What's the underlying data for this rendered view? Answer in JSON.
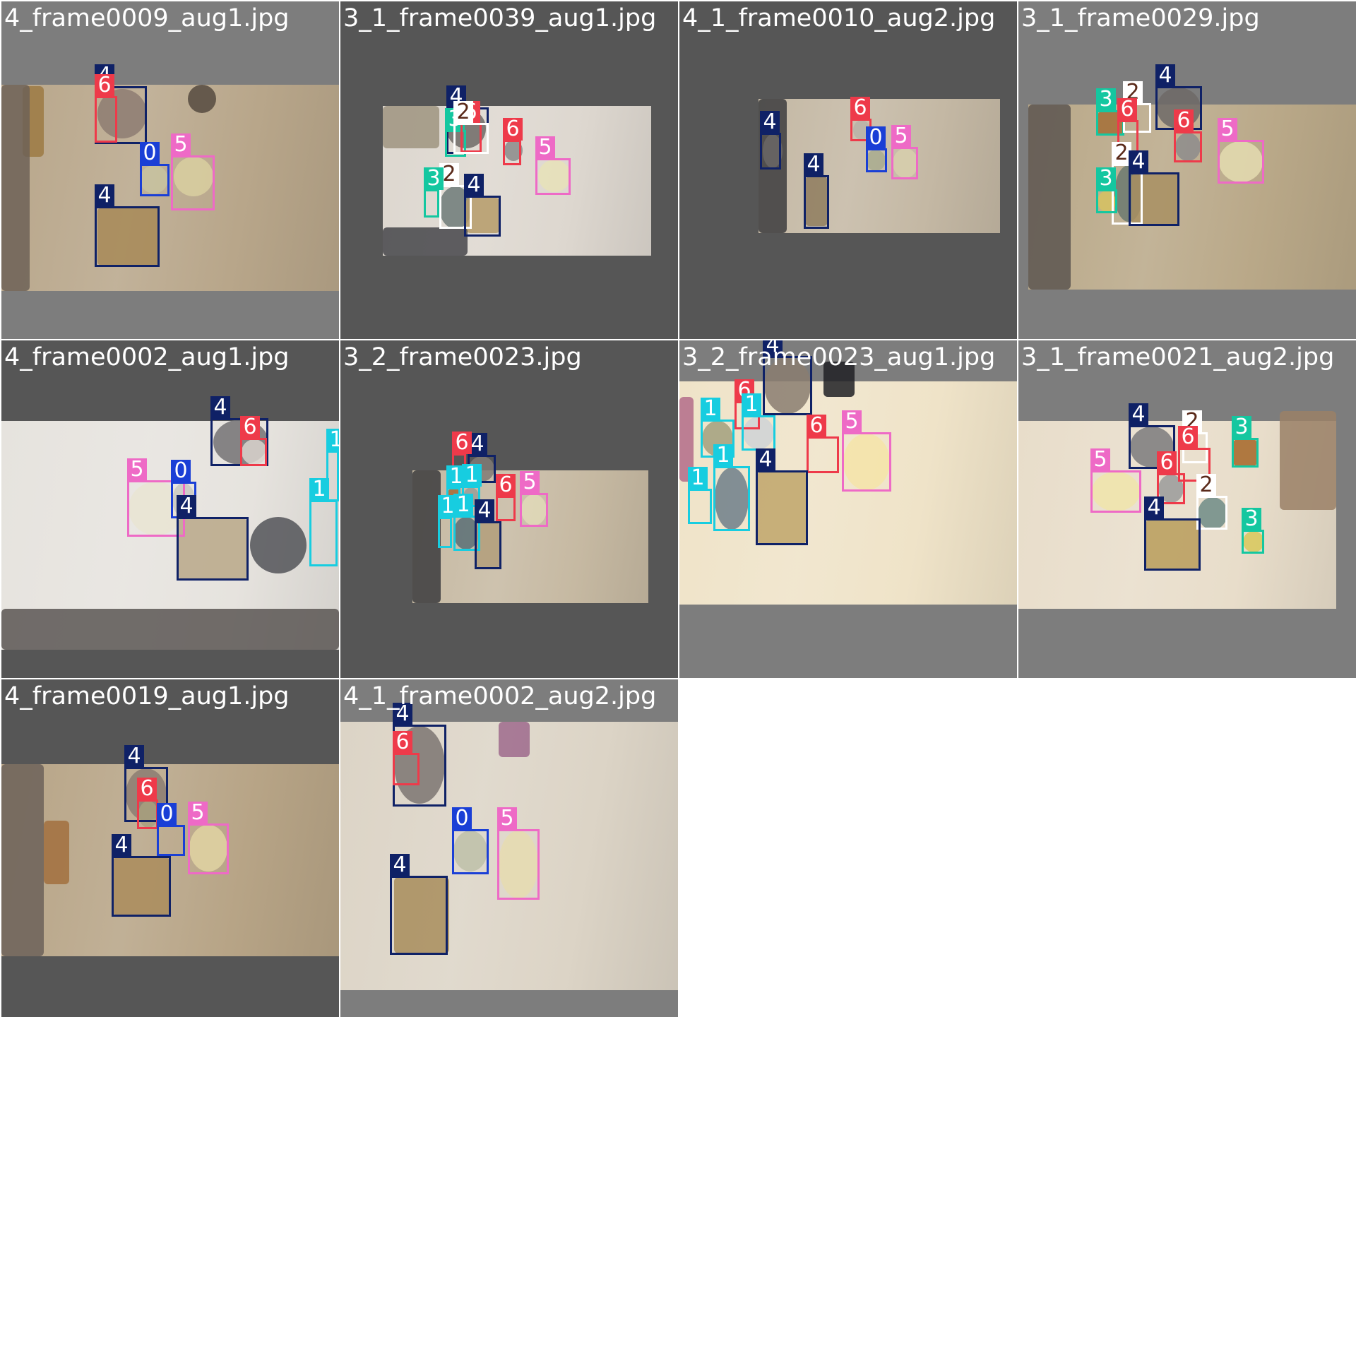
{
  "class_colors": {
    "0": "#1a3fd6",
    "1": "#17cde0",
    "2": "#ffffff",
    "3": "#14c7a0",
    "4": "#0f2166",
    "5": "#ee6ac6",
    "6": "#ee3a4a"
  },
  "class_label_text_colors": {
    "2": "#5a2a1a"
  },
  "background_colors": {
    "light": "#7d7d7d",
    "dark": "#565656",
    "grid": "#ffffff"
  },
  "tiles": [
    {
      "filename": "4_frame0009_aug1.jpg",
      "background": "light",
      "detections": [
        "4",
        "6",
        "0",
        "5",
        "4"
      ]
    },
    {
      "filename": "3_1_frame0039_aug1.jpg",
      "background": "dark",
      "detections": [
        "4",
        "3",
        "6",
        "2",
        "6",
        "5",
        "2",
        "4",
        "3"
      ]
    },
    {
      "filename": "4_1_frame0010_aug2.jpg",
      "background": "dark",
      "detections": [
        "4",
        "6",
        "0",
        "5",
        "4"
      ]
    },
    {
      "filename": "3_1_frame0029.jpg",
      "background": "light",
      "detections": [
        "4",
        "3",
        "2",
        "6",
        "6",
        "5",
        "2",
        "4",
        "3"
      ]
    },
    {
      "filename": "4_frame0002_aug1.jpg",
      "background": "dark",
      "detections": [
        "4",
        "6",
        "1",
        "5",
        "0",
        "4",
        "1"
      ]
    },
    {
      "filename": "3_2_frame0023.jpg",
      "background": "dark",
      "detections": [
        "4",
        "6",
        "1",
        "1",
        "6",
        "5",
        "1",
        "1",
        "4"
      ]
    },
    {
      "filename": "3_2_frame0023_aug1.jpg",
      "background": "light",
      "detections": [
        "4",
        "6",
        "1",
        "1",
        "6",
        "5",
        "1",
        "4",
        "1"
      ]
    },
    {
      "filename": "3_1_frame0021_aug2.jpg",
      "background": "light",
      "detections": [
        "4",
        "2",
        "3",
        "6",
        "5",
        "6",
        "2",
        "4",
        "3"
      ]
    },
    {
      "filename": "4_frame0019_aug1.jpg",
      "background": "dark",
      "detections": [
        "4",
        "6",
        "0",
        "5",
        "4"
      ]
    },
    {
      "filename": "4_1_frame0002_aug2.jpg",
      "background": "light",
      "detections": [
        "4",
        "6",
        "0",
        "5",
        "4"
      ]
    }
  ]
}
